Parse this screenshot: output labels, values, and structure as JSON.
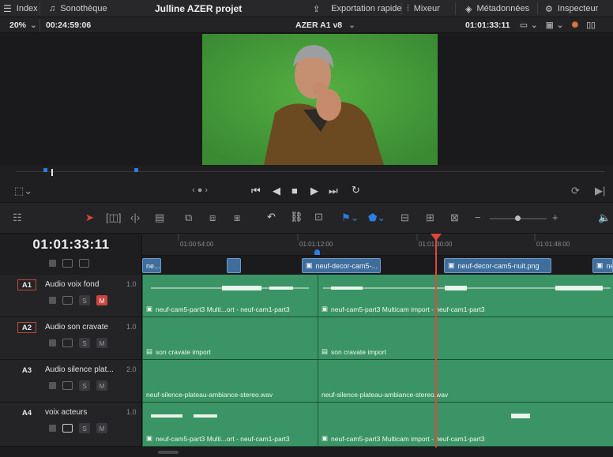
{
  "topbar": {
    "index": "Index",
    "sonotheque": "Sonothèque",
    "project_title": "Julline AZER projet",
    "export": "Exportation rapide",
    "mixer": "Mixeur",
    "metadata": "Métadonnées",
    "inspector": "Inspecteur"
  },
  "viewer_bar": {
    "zoom": "20%",
    "duration": "00:24:59:06",
    "timeline_name": "AZER A1 v8",
    "timecode": "01:01:33:11"
  },
  "timeline": {
    "timecode": "01:01:33:11",
    "ruler": [
      "01:00:54:00",
      "01:01:12:00",
      "01:01:30:00",
      "01:01:48:00"
    ],
    "video_clips": [
      "ne...",
      "neuf-decor-cam5-...",
      "neuf-decor-cam5-nuit.png",
      "ne"
    ],
    "tracks": [
      {
        "id": "A1",
        "name": "Audio voix fond",
        "volume": "1.0",
        "mute_on": true,
        "clips": [
          "neuf-cam5-part3 Multi...ort - neuf-cam1-part3",
          "neuf-cam5-part3 Multicam import - neuf-cam1-part3"
        ]
      },
      {
        "id": "A2",
        "name": "Audio son cravate",
        "volume": "1.0",
        "mute_on": false,
        "clips": [
          "son cravate import",
          "son cravate import"
        ]
      },
      {
        "id": "A3",
        "name": "Audio silence plat...",
        "volume": "2.0",
        "mute_on": false,
        "clips": [
          "neuf-silence-plateau-ambiance-stereo.wav",
          "neuf-silence-plateau-ambiance-stereo.wav"
        ]
      },
      {
        "id": "A4",
        "name": "voix acteurs",
        "volume": "1.0",
        "mute_on": false,
        "clips": [
          "neuf-cam5-part3 Multi...ort - neuf-cam1-part3",
          "neuf-cam5-part3 Multicam import - neuf-cam1-part3"
        ]
      }
    ],
    "solo_label": "S",
    "mute_label": "M"
  },
  "colors": {
    "accent_red": "#e0483c",
    "audio_green": "#2f8254",
    "video_blue": "#3f6e9c"
  }
}
